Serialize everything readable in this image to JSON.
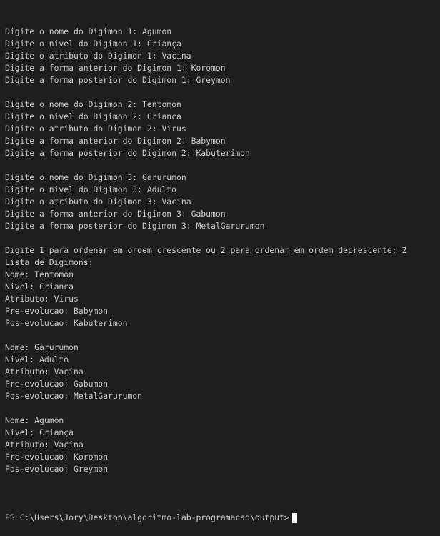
{
  "terminal": {
    "lines": [
      "Digite o nome do Digimon 1: Agumon",
      "Digite o nivel do Digimon 1: Criança",
      "Digite o atributo do Digimon 1: Vacina",
      "Digite a forma anterior do Digimon 1: Koromon",
      "Digite a forma posterior do Digimon 1: Greymon",
      "",
      "Digite o nome do Digimon 2: Tentomon",
      "Digite o nivel do Digimon 2: Crianca",
      "Digite o atributo do Digimon 2: Virus",
      "Digite a forma anterior do Digimon 2: Babymon",
      "Digite a forma posterior do Digimon 2: Kabuterimon",
      "",
      "Digite o nome do Digimon 3: Garurumon",
      "Digite o nivel do Digimon 3: Adulto",
      "Digite o atributo do Digimon 3: Vacina",
      "Digite a forma anterior do Digimon 3: Gabumon",
      "Digite a forma posterior do Digimon 3: MetalGarurumon",
      "",
      "Digite 1 para ordenar em ordem crescente ou 2 para ordenar em ordem decrescente: 2",
      "Lista de Digimons:",
      "Nome: Tentomon",
      "Nivel: Crianca",
      "Atributo: Virus",
      "Pre-evolucao: Babymon",
      "Pos-evolucao: Kabuterimon",
      "",
      "Nome: Garurumon",
      "Nivel: Adulto",
      "Atributo: Vacina",
      "Pre-evolucao: Gabumon",
      "Pos-evolucao: MetalGarurumon",
      "",
      "Nome: Agumon",
      "Nivel: Criança",
      "Atributo: Vacina",
      "Pre-evolucao: Koromon",
      "Pos-evolucao: Greymon",
      ""
    ],
    "prompt": "PS C:\\Users\\Jory\\Desktop\\algoritmo-lab-programacao\\output>",
    "colors": {
      "background": "#1e1e1e",
      "text": "#cccccc",
      "cursor": "#ffffff"
    }
  }
}
